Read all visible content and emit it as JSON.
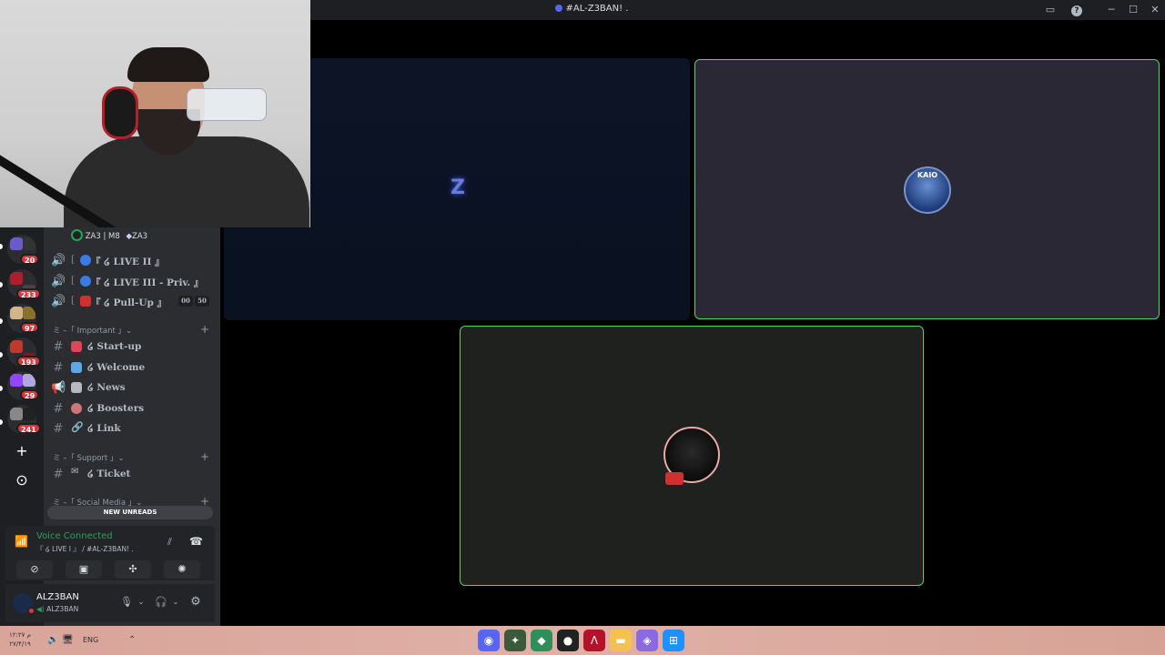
{
  "window": {
    "title": "#AL-Z3BAN! ."
  },
  "servers": [
    {
      "badge": "20"
    },
    {
      "badge": "233"
    },
    {
      "badge": "97"
    },
    {
      "badge": "193"
    },
    {
      "badge": "29"
    },
    {
      "badge": "241"
    }
  ],
  "server": {
    "header_label": "ZA3 | M8",
    "header_tag": "ZA3"
  },
  "voice_channels": [
    {
      "name": "『 ໒ LIVE II 』",
      "emoji_color": "#3c7be6"
    },
    {
      "name": "『 ໒ LIVE III - Priv. 』",
      "emoji_color": "#3c7be6"
    },
    {
      "name": "『 ໒ Pull-Up 』",
      "emoji_color": "#d03030",
      "count_a": "00",
      "count_b": "50"
    }
  ],
  "categories": {
    "important": "ミ –「 Important 」⌄",
    "support": "ミ –「 Support 」⌄",
    "social": "ミ –「 Social Media 」⌄"
  },
  "text_channels": [
    {
      "name": "໒ Start-up",
      "emoji_color": "#e0455a"
    },
    {
      "name": "໒ Welcome",
      "emoji_color": "#5fa8e8"
    },
    {
      "name": "໒ News",
      "emoji_color": "#b5bac1"
    },
    {
      "name": "໒ Boosters",
      "emoji_color": "#c77"
    },
    {
      "name": "໒ Link",
      "emoji_color": "#dbdee1"
    },
    {
      "name": "໒ Ticket",
      "emoji_color": "#b5bac1"
    }
  ],
  "new_unreads": "NEW UNREADS",
  "voice": {
    "status": "Voice Connected",
    "channel": "『 ໒ LIVE I 』 / #AL-Z3BAN! ."
  },
  "user": {
    "name": "ALZ3BAN",
    "status": "ALZ3BAN"
  },
  "tiles": {
    "kaio_text": "KAIO"
  },
  "taskbar": {
    "time": "۱۲:۲۷ م",
    "date": "۲۷/۴/۱۹",
    "lang": "ENG"
  },
  "colors": {
    "accent": "#5865f2",
    "voice_green": "#23a55a",
    "tile_border": "#56d364",
    "badge_red": "#da373c"
  }
}
